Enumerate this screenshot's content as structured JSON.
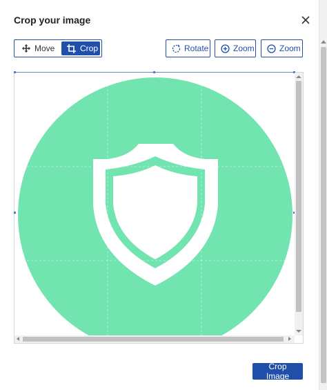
{
  "dialog": {
    "title": "Crop your image",
    "close_icon": "close-icon"
  },
  "toolbar": {
    "mode_toggle": {
      "move_label": "Move",
      "move_icon": "move-arrows-icon",
      "crop_label": "Crop",
      "crop_icon": "crop-icon",
      "selected": "Crop"
    },
    "rotate_label": "Rotate",
    "rotate_icon": "rotate-icon",
    "zoom_in_label": "Zoom",
    "zoom_in_icon": "zoom-in-icon",
    "zoom_out_label": "Zoom",
    "zoom_out_icon": "zoom-out-icon"
  },
  "image": {
    "description_icon": "shield-icon",
    "circle_color": "#72e4b0",
    "shield_color": "#ffffff"
  },
  "colors": {
    "accent": "#1f4fa8",
    "crop_frame": "#5a8ad6"
  },
  "footer": {
    "crop_image_label": "Crop Image"
  }
}
